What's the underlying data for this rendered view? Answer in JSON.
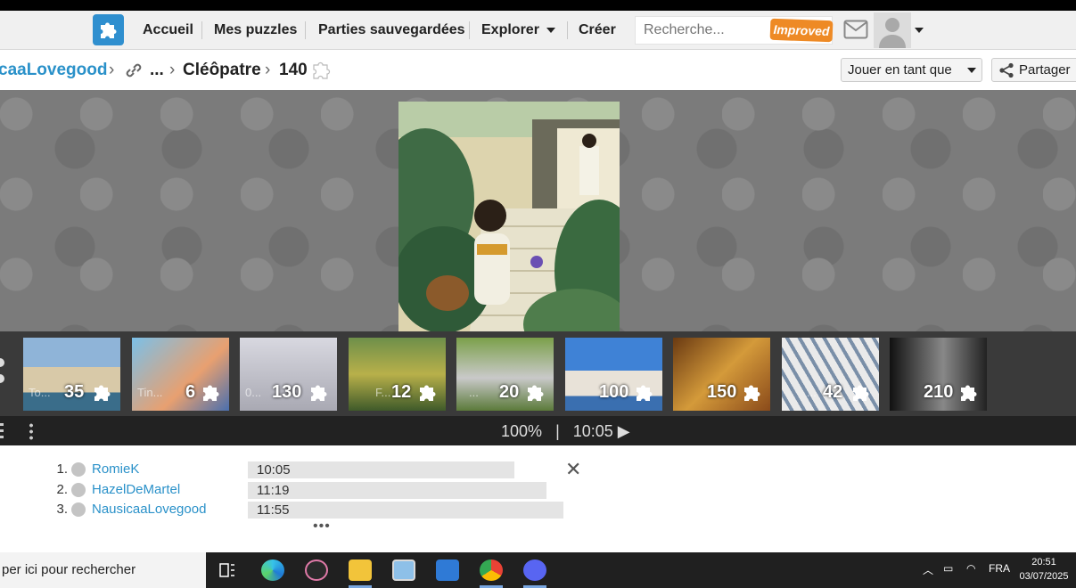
{
  "nav": {
    "home": "Accueil",
    "my_puzzles": "Mes puzzles",
    "saved_games": "Parties sauvegardées",
    "explore": "Explorer",
    "create": "Créer",
    "search_placeholder": "Recherche...",
    "improved_badge": "Improved"
  },
  "breadcrumb": {
    "user": "caaLovegood",
    "ellipsis": "...",
    "title": "Cléôpatre",
    "pieces": "140",
    "play_as": "Jouer en tant que",
    "share": "Partager"
  },
  "thumbnails": [
    {
      "title": "To...",
      "count": "35"
    },
    {
      "title": "Tin...",
      "count": "6"
    },
    {
      "title": "0...",
      "count": "130"
    },
    {
      "title": "F...",
      "count": "12"
    },
    {
      "title": "...",
      "count": "20"
    },
    {
      "title": "",
      "count": "100"
    },
    {
      "title": "",
      "count": "150"
    },
    {
      "title": "...",
      "count": "42"
    },
    {
      "title": "",
      "count": "210"
    }
  ],
  "status": {
    "zoom": "100%",
    "separator": "|",
    "time": "10:05 ▶"
  },
  "leaderboard": [
    {
      "rank": "1.",
      "name": "RomieK",
      "time": "10:05",
      "bar_fraction": 0.55
    },
    {
      "rank": "2.",
      "name": "HazelDeMartel",
      "time": "11:19",
      "bar_fraction": 0.62
    },
    {
      "rank": "3.",
      "name": "NausicaaLovegood",
      "time": "11:55",
      "bar_fraction": 0.65
    }
  ],
  "leaderboard_more": "•••",
  "taskbar": {
    "search_text": "per ici pour rechercher",
    "lang": "FRA",
    "time": "20:51",
    "date": "03/07/2025"
  },
  "colors": {
    "accent": "#2a91c9",
    "improved": "#ee8a25",
    "taskbar": "#202020"
  }
}
